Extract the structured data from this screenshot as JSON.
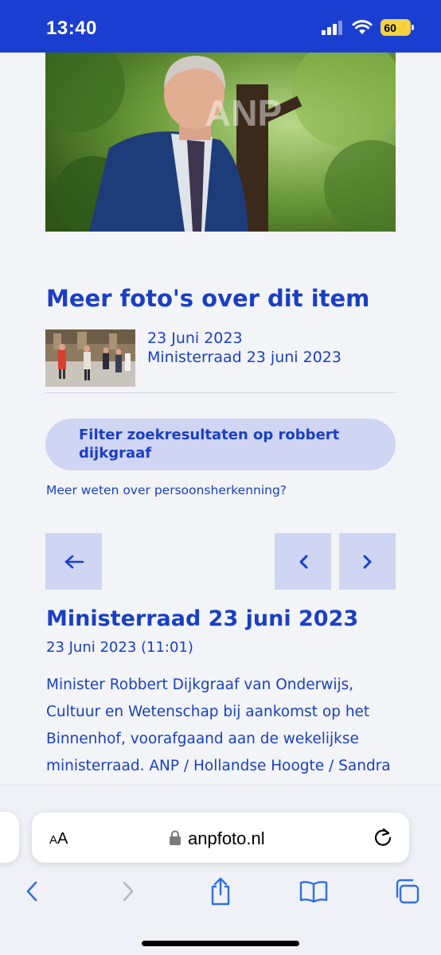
{
  "status_bar": {
    "time": "13:40",
    "battery": "60"
  },
  "hero": {
    "watermark": "ANP"
  },
  "more_photos": {
    "heading": "Meer foto's over dit item",
    "item": {
      "date": "23 Juni 2023",
      "title": "Ministerraad 23 juni 2023"
    }
  },
  "filter_button": {
    "label": "Filter zoekresultaten op robbert dijkgraaf"
  },
  "help_link": {
    "label": "Meer weten over persoonsherkenning?"
  },
  "navigation": {
    "back_icon": "arrow-left-icon",
    "prev_icon": "chevron-left-icon",
    "next_icon": "chevron-right-icon"
  },
  "detail": {
    "title": "Ministerraad 23 juni 2023",
    "datetime": "23 Juni 2023 (11:01)",
    "description": "Minister Robbert Dijkgraaf van Onderwijs, Cultuur en Wetenschap bij aankomst op het Binnenhof, voorafgaand aan de wekelijkse ministerraad. ANP / Hollandse Hoogte / Sandra Uittenbogaart"
  },
  "browser": {
    "text_size_label_small": "A",
    "text_size_label_large": "A",
    "url": "anpfoto.nl"
  },
  "colors": {
    "brand_blue": "#1a3fc4",
    "status_blue": "#1a3fd0",
    "button_bg": "#cfd5f2",
    "page_bg": "#f3f4f8",
    "ios_blue": "#2f6fe6"
  }
}
